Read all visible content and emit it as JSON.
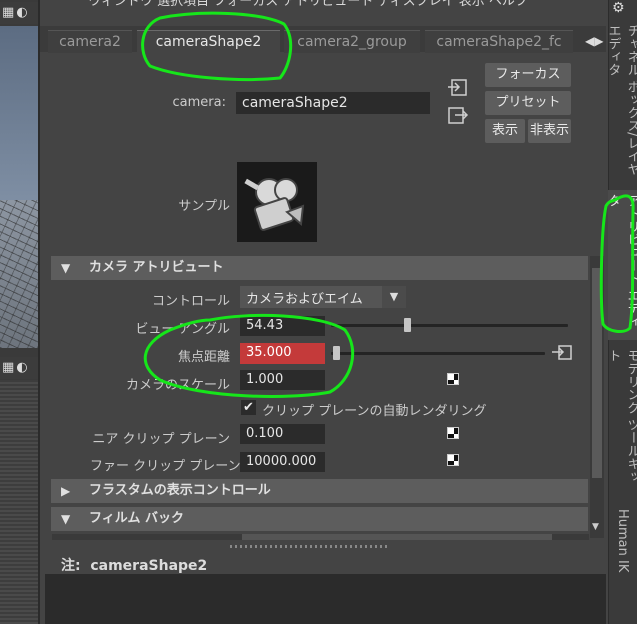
{
  "menubar": {
    "items_text": "ウィンドウ  選択項目  フォーカス  アトリビュート  ディスプレイ  表示  ヘルプ"
  },
  "viewport": {
    "top_icons": [
      "▦",
      "◐",
      "✦"
    ],
    "bottom_icons": [
      "▦",
      "◐",
      "✦"
    ]
  },
  "tabs": [
    {
      "label": "camera2",
      "active": false
    },
    {
      "label": "cameraShape2",
      "active": true
    },
    {
      "label": "camera2_group",
      "active": false
    },
    {
      "label": "cameraShape2_fc",
      "active": false
    }
  ],
  "tab_arrows": {
    "left": "◀",
    "right": "▶"
  },
  "node": {
    "label": "camera:",
    "value": "cameraShape2"
  },
  "buttons": {
    "focus": "フォーカス",
    "preset": "プリセット",
    "show": "表示",
    "hide": "非表示"
  },
  "sample_label": "サンプル",
  "sections": {
    "camera_attributes": "カメラ アトリビュート",
    "frustum": "フラスタムの表示コントロール",
    "film_back": "フィルム バック"
  },
  "attributes": {
    "control": {
      "label": "コントロール",
      "value": "カメラおよびエイム"
    },
    "view_angle": {
      "label": "ビュー アングル",
      "value": "54.43",
      "slider_fraction": 0.31
    },
    "focal_length": {
      "label": "焦点距離",
      "value": "35.000",
      "slider_fraction": 0.01,
      "highlight_color": "#c43a3a"
    },
    "camera_scale": {
      "label": "カメラのスケール",
      "value": "1.000"
    },
    "auto_clip": {
      "label": "クリップ プレーンの自動レンダリング",
      "checked": true
    },
    "near_clip": {
      "label": "ニア クリップ プレーン",
      "value": "0.100"
    },
    "far_clip": {
      "label": "ファー クリップ プレーン",
      "value": "10000.000"
    }
  },
  "notes": {
    "label": "注:  cameraShape2"
  },
  "right_tabs": [
    {
      "label": "チャネル ボックス/レイヤ エディタ",
      "active": false
    },
    {
      "label": "アトリビュート エディタ",
      "active": true
    },
    {
      "label": "モデリング ツールキット",
      "active": false
    },
    {
      "label": "Human IK",
      "active": false
    }
  ],
  "colors": {
    "annotation": "#16e61a",
    "panel_bg": "#444444",
    "field_bg": "#2b2b2b"
  }
}
